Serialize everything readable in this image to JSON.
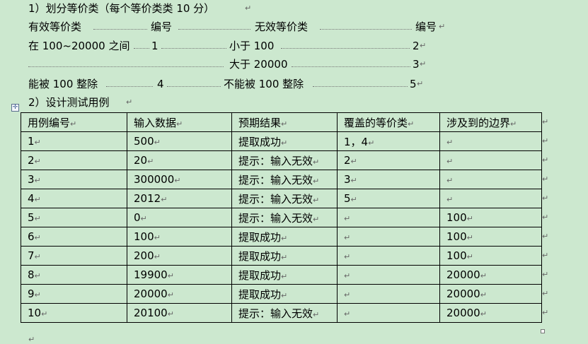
{
  "section1": {
    "heading": "1）划分等价类（每个等价类类 10 分）",
    "header_row": [
      "有效等价类",
      "编号",
      "无效等价类",
      "编号"
    ],
    "rows": [
      [
        "在 100~20000 之间",
        "1",
        "小于 100",
        "2"
      ],
      [
        "",
        "",
        "大于 20000",
        "3"
      ],
      [
        "能被 100 整除",
        "4",
        "不能被 100 整除",
        "5"
      ]
    ]
  },
  "section2": {
    "heading": "2）设计测试用例",
    "table": {
      "headers": [
        "用例编号",
        "输入数据",
        "预期结果",
        "覆盖的等价类",
        "涉及到的边界"
      ],
      "rows": [
        [
          "1",
          "500",
          "提取成功",
          "1，4",
          ""
        ],
        [
          "2",
          "20",
          "提示：输入无效",
          "2",
          ""
        ],
        [
          "3",
          "300000",
          "提示：输入无效",
          "3",
          ""
        ],
        [
          "4",
          "2012",
          "提示：输入无效",
          "5",
          ""
        ],
        [
          "5",
          "0",
          "提示：输入无效",
          "",
          "100"
        ],
        [
          "6",
          "100",
          "提取成功",
          "",
          "100"
        ],
        [
          "7",
          "200",
          "提取成功",
          "",
          "100"
        ],
        [
          "8",
          "19900",
          "提取成功",
          "",
          "20000"
        ],
        [
          "9",
          "20000",
          "提取成功",
          "",
          "20000"
        ],
        [
          "10",
          "20100",
          "提示：输入无效",
          "",
          "20000"
        ]
      ]
    }
  },
  "marks": {
    "paragraph": "↵",
    "table_move_icon": "move-handle-icon"
  },
  "colors": {
    "page_background": "#cce8cf",
    "text": "#000000",
    "formatting_mark": "#666666"
  }
}
